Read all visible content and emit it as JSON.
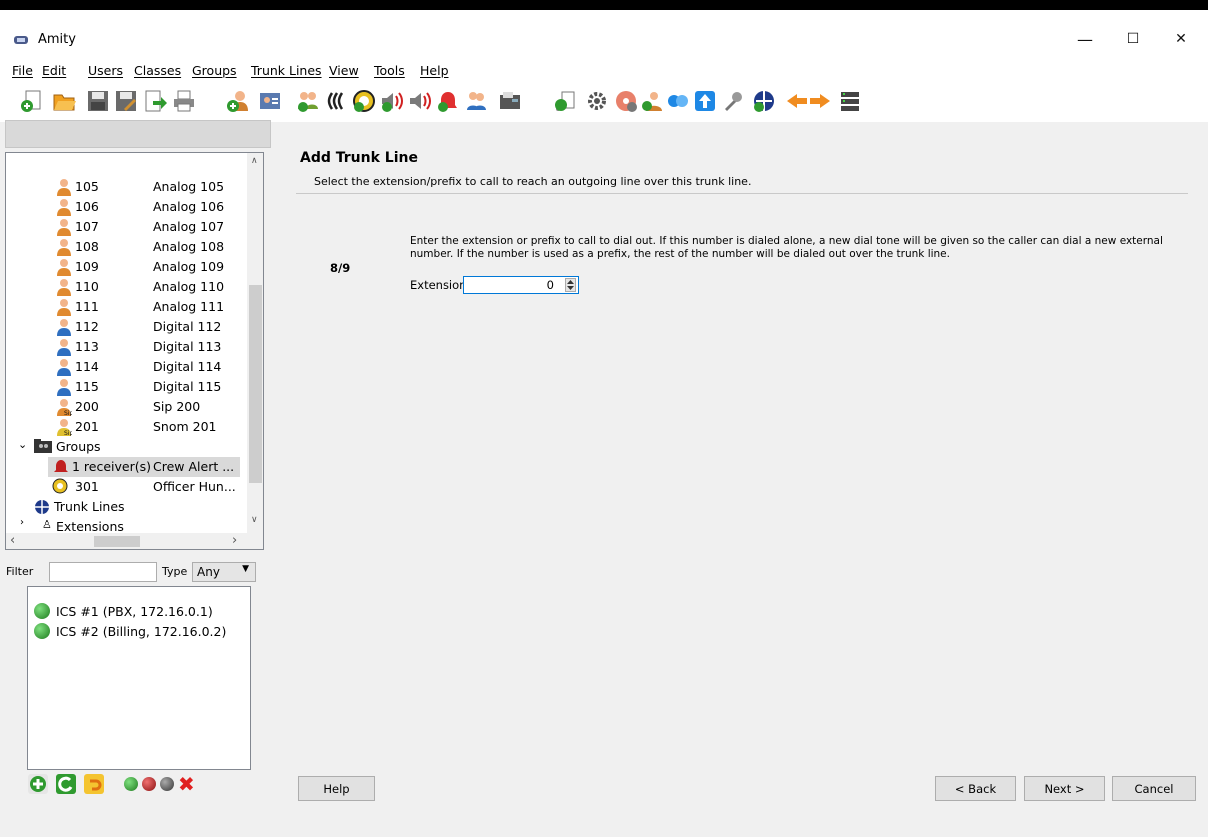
{
  "window": {
    "title": "Amity",
    "controls": {
      "minimize": "—",
      "maximize": "☐",
      "close": "✕"
    }
  },
  "menu": [
    "File",
    "Edit",
    "Users",
    "Classes",
    "Groups",
    "Trunk Lines",
    "View",
    "Tools",
    "Help"
  ],
  "toolbar": {
    "icons": [
      "new-icon",
      "open-folder-icon",
      "save-icon",
      "save-as-icon",
      "export-icon",
      "print-icon",
      "add-user-icon",
      "user-card-icon",
      "add-group-icon",
      "phone-group-icon",
      "add-ring-group-icon",
      "speaker-icon",
      "add-speaker-icon",
      "add-alert-icon",
      "add-users-icon",
      "fax-icon",
      "settings-dial-icon",
      "gear-icon",
      "disc-gear-icon",
      "user-config-icon",
      "connect-icon",
      "upload-icon",
      "tools-icon",
      "add-trunk-icon",
      "back-arrow-icon",
      "forward-arrow-icon",
      "server-list-icon"
    ]
  },
  "tree": {
    "extensions": [
      {
        "num": "105",
        "name": "Analog 105",
        "type": "analog"
      },
      {
        "num": "106",
        "name": "Analog 106",
        "type": "analog"
      },
      {
        "num": "107",
        "name": "Analog 107",
        "type": "analog"
      },
      {
        "num": "108",
        "name": "Analog 108",
        "type": "analog"
      },
      {
        "num": "109",
        "name": "Analog 109",
        "type": "analog"
      },
      {
        "num": "110",
        "name": "Analog 110",
        "type": "analog"
      },
      {
        "num": "111",
        "name": "Analog 111",
        "type": "analog"
      },
      {
        "num": "112",
        "name": "Digital 112",
        "type": "digital"
      },
      {
        "num": "113",
        "name": "Digital 113",
        "type": "digital"
      },
      {
        "num": "114",
        "name": "Digital 114",
        "type": "digital"
      },
      {
        "num": "115",
        "name": "Digital 115",
        "type": "digital"
      },
      {
        "num": "200",
        "name": "Sip 200",
        "type": "sip"
      },
      {
        "num": "201",
        "name": "Snom 201",
        "type": "snom"
      }
    ],
    "groups_label": "Groups",
    "groups": [
      {
        "num": "1 receiver(s)",
        "name": "Crew Alert ..."
      },
      {
        "num": "301",
        "name": "Officer Hun..."
      }
    ],
    "trunk_lines_label": "Trunk Lines",
    "extensions_label": "Extensions"
  },
  "filter": {
    "label": "Filter",
    "value": "",
    "type_label": "Type",
    "type_value": "Any"
  },
  "servers": [
    {
      "label": "ICS #1 (PBX, 172.16.0.1)",
      "status_color": "#2e9a2e"
    },
    {
      "label": "ICS #2 (Billing, 172.16.0.2)",
      "status_color": "#2e9a2e"
    }
  ],
  "bottom_icons": [
    "add-circle-icon",
    "refresh-icon",
    "undo-icon",
    "green-dot-icon",
    "red-dot-icon",
    "gray-dot-icon",
    "delete-x-icon"
  ],
  "wizard": {
    "title": "Add Trunk Line",
    "subtitle": "Select the extension/prefix to call to reach an outgoing line over this trunk line.",
    "step": "8/9",
    "description": "Enter the extension or prefix to call to dial out. If this number is dialed alone, a new dial tone will be given so the caller can dial a new external number. If the number is used as a prefix, the rest of the number will be dialed out over the trunk line.",
    "extension_label": "Extension",
    "extension_value": "0"
  },
  "buttons": {
    "help": "Help",
    "back": "< Back",
    "next": "Next >",
    "cancel": "Cancel"
  }
}
